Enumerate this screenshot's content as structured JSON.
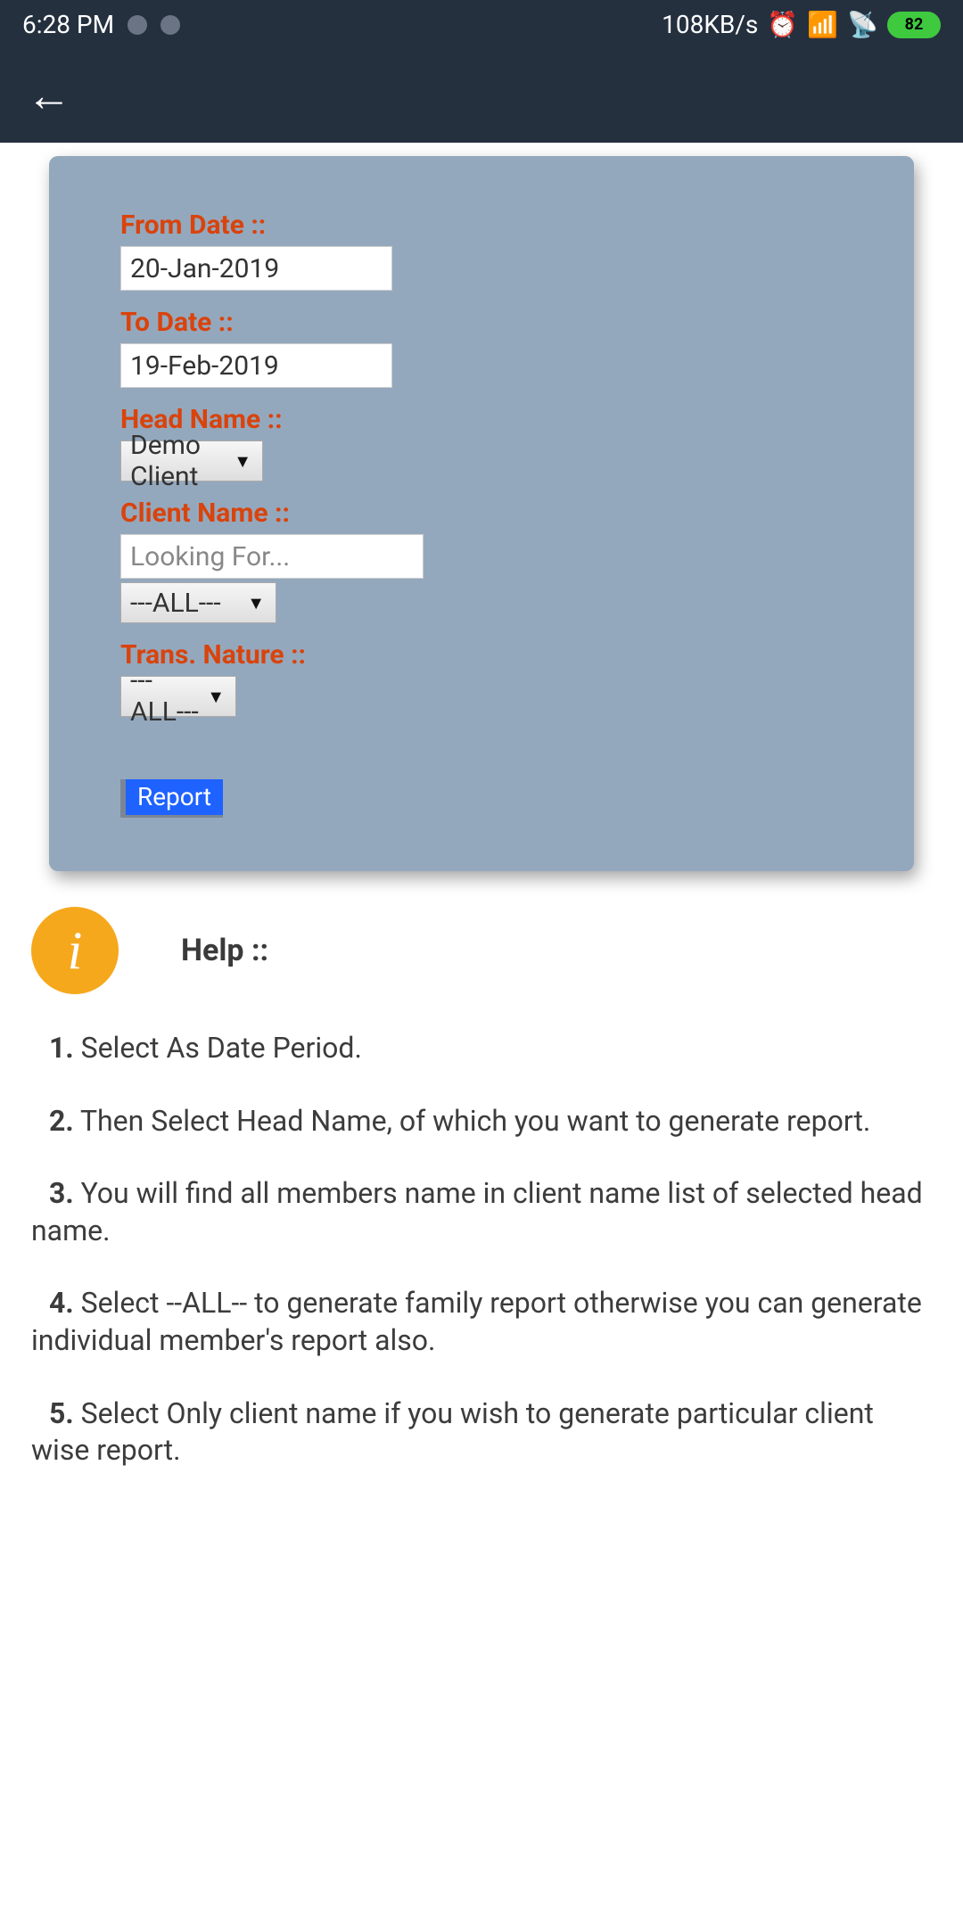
{
  "status": {
    "time": "6:28 PM",
    "speed": "108KB/s",
    "battery": "82"
  },
  "form": {
    "from_date_label": "From Date ::",
    "from_date_value": "20-Jan-2019",
    "to_date_label": "To Date ::",
    "to_date_value": "19-Feb-2019",
    "head_name_label": "Head Name ::",
    "head_name_value": "Demo Client",
    "client_name_label": "Client Name ::",
    "client_name_placeholder": "Looking For...",
    "client_name_select": "---ALL---",
    "trans_nature_label": "Trans. Nature ::",
    "trans_nature_select": "---ALL---",
    "report_button": "Report"
  },
  "help": {
    "title": "Help ::",
    "items": [
      {
        "num": "1.",
        "text": " Select As Date Period."
      },
      {
        "num": "2.",
        "text": " Then Select Head Name, of which you want to generate report."
      },
      {
        "num": "3.",
        "text": " You will find all members name in client name list of selected head name."
      },
      {
        "num": "4.",
        "text": " Select --ALL-- to generate family report otherwise you can generate individual member's report also."
      },
      {
        "num": "5.",
        "text": " Select Only client name if you wish to generate particular client wise report."
      }
    ]
  }
}
